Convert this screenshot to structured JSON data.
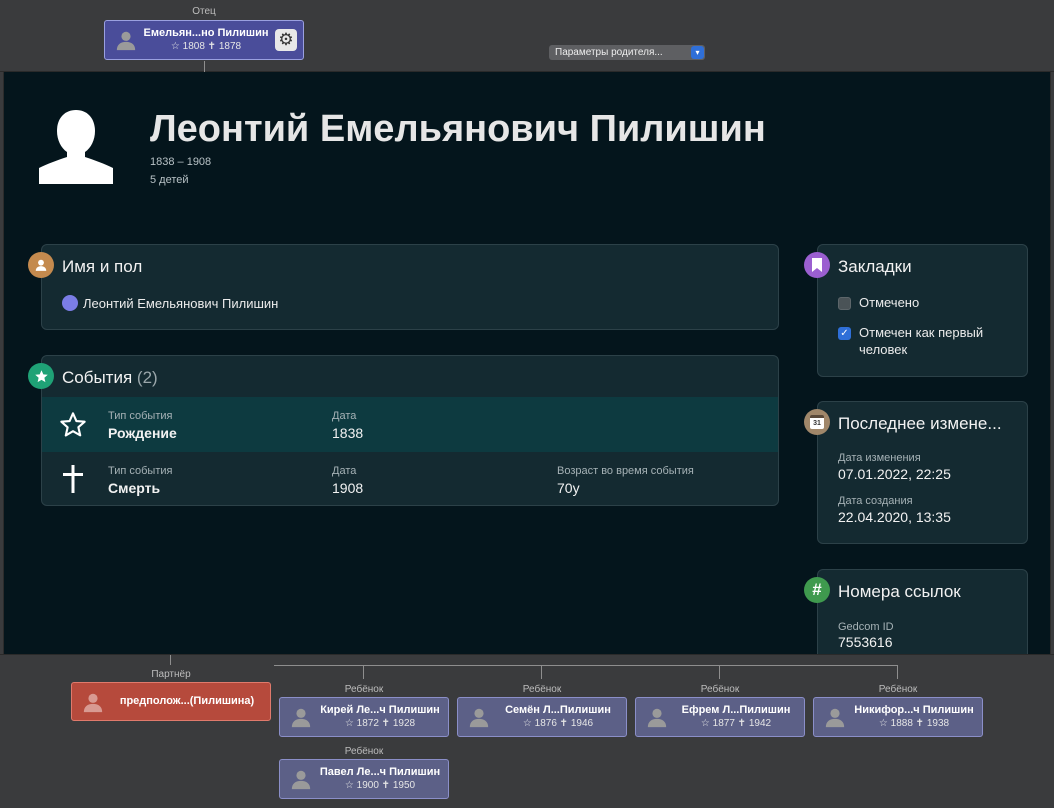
{
  "father": {
    "label": "Отец",
    "name": "Емельян...но Пилишин",
    "birth": "1808",
    "death": "1878"
  },
  "parent_options": "Параметры родителя...",
  "person": {
    "name": "Леонтий Емельянович Пилишин",
    "lifespan": "1838 – 1908",
    "children": "5 детей"
  },
  "name_section": {
    "title": "Имя и пол",
    "name": "Леонтий Емельянович Пилишин"
  },
  "events": {
    "title": "События",
    "count": "(2)",
    "items": [
      {
        "type_label": "Тип события",
        "type": "Рождение",
        "date_label": "Дата",
        "date": "1838",
        "age_label": "",
        "age": ""
      },
      {
        "type_label": "Тип события",
        "type": "Смерть",
        "date_label": "Дата",
        "date": "1908",
        "age_label": "Возраст во время события",
        "age": "70y"
      }
    ]
  },
  "bookmarks": {
    "title": "Закладки",
    "marked": "Отмечено",
    "first_person": "Отмечен как первый человек",
    "marked_checked": false,
    "first_checked": true
  },
  "last_change": {
    "title": "Последнее измене...",
    "changed_label": "Дата изменения",
    "changed": "07.01.2022, 22:25",
    "created_label": "Дата создания",
    "created": "22.04.2020, 13:35",
    "calendar_day": "31"
  },
  "references": {
    "title": "Номера ссылок",
    "gedcom_label": "Gedcom ID",
    "gedcom": "7553616"
  },
  "partner": {
    "label": "Партнёр",
    "name": "предполож...(Пилишина)"
  },
  "children": [
    {
      "label": "Ребёнок",
      "name": "Кирей Ле...ч Пилишин",
      "birth": "1872",
      "death": "1928"
    },
    {
      "label": "Ребёнок",
      "name": "Семён Л...Пилишин",
      "birth": "1876",
      "death": "1946"
    },
    {
      "label": "Ребёнок",
      "name": "Ефрем Л...Пилишин",
      "birth": "1877",
      "death": "1942"
    },
    {
      "label": "Ребёнок",
      "name": "Никифор...ч Пилишин",
      "birth": "1888",
      "death": "1938"
    },
    {
      "label": "Ребёнок",
      "name": "Павел Ле...ч Пилишин",
      "birth": "1900",
      "death": "1950"
    }
  ],
  "colors": {
    "main_bg": "#04151c",
    "card_bg": "#142a31",
    "person_card": "#5c6087",
    "partner_card": "#b64a3c",
    "accent_orange": "#c48a4e",
    "accent_green": "#1fa276",
    "accent_purple": "#9b5fd0",
    "accent_hash": "#3f9a4e"
  }
}
